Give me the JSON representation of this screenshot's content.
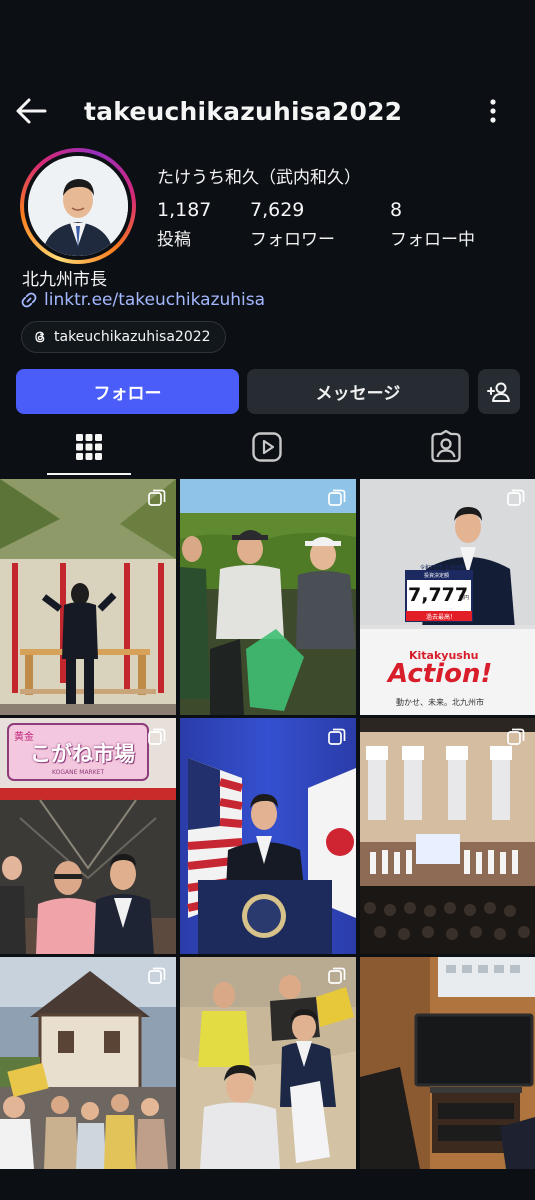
{
  "header": {
    "username": "takeuchikazuhisa2022"
  },
  "profile": {
    "full_name": "たけうち和久（武内和久）",
    "stats": [
      {
        "value": "1,187",
        "label": "投稿"
      },
      {
        "value": "7,629",
        "label": "フォロワー"
      },
      {
        "value": "8",
        "label": "フォロー中"
      }
    ],
    "bio": "北九州市長",
    "link": "linktr.ee/takeuchikazuhisa",
    "threads_handle": "takeuchikazuhisa2022"
  },
  "actions": {
    "follow_label": "フォロー",
    "message_label": "メッセージ"
  },
  "tabs": [
    "grid-icon",
    "reels-icon",
    "tagged-icon"
  ],
  "posts": {
    "p3_sign_text": "令和7年度 企画課題",
    "p3_board_caption": "投資決定額",
    "p3_number": "7,777",
    "p3_unit": "億円",
    "p3_record": "過去最高！",
    "p3_brand": "Kitakyushu",
    "p3_action": "Action!",
    "p3_slogan": "動かせ、未来。北九州市",
    "p4_sign_small": "黄金",
    "p4_sign_big": "こがね市場",
    "p4_sign_en": "KOGANE MARKET"
  },
  "colors": {
    "follow_blue": "#4a5df9",
    "link_blue": "#a4b8ff",
    "background": "#0c1014",
    "secondary_button": "#262c31"
  }
}
